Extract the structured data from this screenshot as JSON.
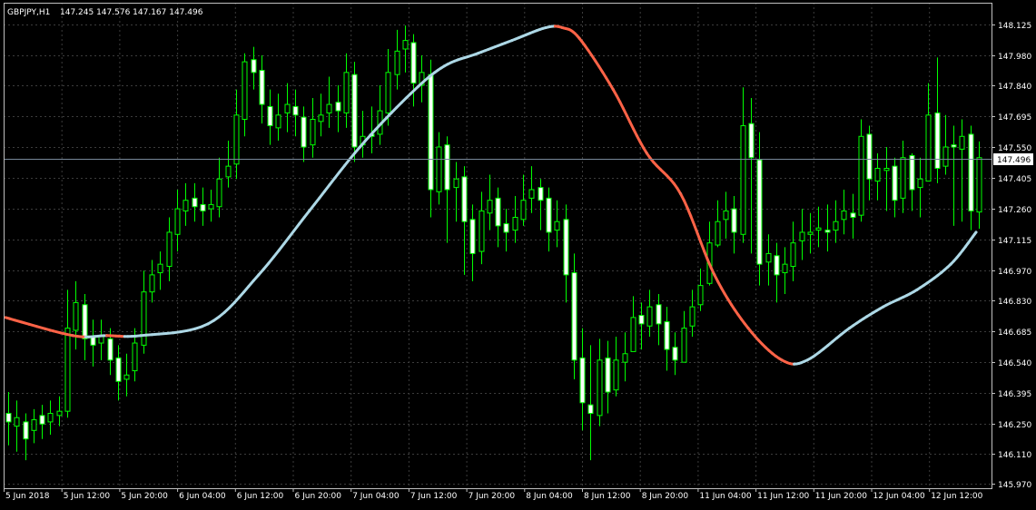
{
  "header": {
    "symbol": "GBPJPY,H1",
    "quote": "147.245 147.576 147.167 147.496"
  },
  "colors": {
    "background": "#000000",
    "grid": "#3c3c3c",
    "frame": "#c0c0c0",
    "candle": "#00ff00",
    "ma_up": "#add8e6",
    "ma_down": "#ff6347",
    "price_line": "#778899",
    "text": "#ffffff"
  },
  "chart_data": {
    "type": "candlestick",
    "title": "GBPJPY,H1",
    "ohlc_label": "147.245 147.576 147.167 147.496",
    "ylim": [
      145.97,
      148.17
    ],
    "y_ticks": [
      148.125,
      147.98,
      147.84,
      147.695,
      147.55,
      147.405,
      147.26,
      147.115,
      146.97,
      146.83,
      146.685,
      146.54,
      146.395,
      146.25,
      146.11,
      145.97
    ],
    "y_tick_labels": [
      "148.125",
      "147.980",
      "147.840",
      "147.695",
      "147.550",
      "147.405",
      "147.260",
      "147.115",
      "146.970",
      "146.830",
      "146.685",
      "146.540",
      "146.395",
      "146.250",
      "146.110",
      "145.970"
    ],
    "x_labels": [
      "5 Jun 2018",
      "5 Jun 12:00",
      "5 Jun 20:00",
      "6 Jun 04:00",
      "6 Jun 12:00",
      "6 Jun 20:00",
      "7 Jun 04:00",
      "7 Jun 12:00",
      "7 Jun 20:00",
      "8 Jun 04:00",
      "8 Jun 12:00",
      "8 Jun 20:00",
      "11 Jun 04:00",
      "11 Jun 12:00",
      "11 Jun 20:00",
      "12 Jun 04:00",
      "12 Jun 12:00"
    ],
    "current_price": 147.496,
    "current_price_label": "147.496",
    "grid": true,
    "series": [
      {
        "type": "candlestick",
        "color": "#00ff00",
        "close": [
          146.26,
          146.28,
          146.18,
          146.27,
          146.25,
          146.3,
          146.31,
          146.7,
          146.82,
          146.65,
          146.62,
          146.66,
          146.55,
          146.45,
          146.48,
          146.63,
          146.87,
          146.95,
          147.0,
          147.15,
          147.26,
          147.3,
          147.27,
          147.25,
          147.28,
          147.4,
          147.46,
          147.7,
          147.95,
          147.9,
          147.75,
          147.65,
          147.7,
          147.75,
          147.7,
          147.55,
          147.68,
          147.7,
          147.75,
          147.72,
          147.9,
          147.55,
          147.6,
          147.6,
          147.72,
          147.9,
          148.0,
          148.05,
          147.85,
          147.9,
          147.35,
          147.55,
          147.35,
          147.4,
          147.2,
          147.05,
          147.25,
          147.3,
          147.18,
          147.15,
          147.22,
          147.3,
          147.35,
          147.3,
          147.15,
          147.2,
          146.95,
          146.55,
          146.35,
          146.3,
          146.55,
          146.4,
          146.55,
          146.58,
          146.75,
          146.72,
          146.8,
          146.72,
          146.6,
          146.55,
          146.7,
          146.8,
          146.9,
          147.1,
          147.2,
          147.25,
          147.15,
          147.65,
          147.5,
          147.0,
          147.05,
          146.95,
          147.0,
          147.1,
          147.15,
          147.15,
          147.17,
          147.15,
          147.2,
          147.25,
          147.22,
          147.6,
          147.4,
          147.45,
          147.45,
          147.3,
          147.5,
          147.35,
          147.4,
          147.7,
          147.45,
          147.55,
          147.55,
          147.6,
          147.25,
          147.5
        ],
        "open": [
          146.3,
          146.24,
          146.26,
          146.22,
          146.29,
          146.26,
          146.29,
          146.31,
          146.69,
          146.81,
          146.66,
          146.63,
          146.65,
          146.56,
          146.46,
          146.5,
          146.62,
          146.87,
          146.96,
          146.99,
          147.14,
          147.25,
          147.31,
          147.28,
          147.26,
          147.27,
          147.41,
          147.47,
          147.68,
          147.96,
          147.91,
          147.74,
          147.64,
          147.71,
          147.74,
          147.69,
          147.56,
          147.67,
          147.71,
          147.76,
          147.71,
          147.89,
          147.56,
          147.61,
          147.61,
          147.71,
          147.89,
          148.01,
          148.04,
          147.84,
          147.89,
          147.34,
          147.56,
          147.36,
          147.41,
          147.21,
          147.06,
          147.24,
          147.31,
          147.19,
          147.16,
          147.21,
          147.31,
          147.36,
          147.31,
          147.16,
          147.21,
          146.96,
          146.56,
          146.34,
          146.29,
          146.56,
          146.41,
          146.54,
          146.59,
          146.76,
          146.71,
          146.81,
          146.73,
          146.61,
          146.54,
          146.71,
          146.81,
          146.91,
          147.09,
          147.21,
          147.26,
          147.14,
          147.66,
          147.49,
          147.01,
          147.04,
          146.96,
          146.99,
          147.11,
          147.14,
          147.16,
          147.16,
          147.16,
          147.21,
          147.24,
          147.23,
          147.61,
          147.39,
          147.44,
          147.46,
          147.31,
          147.51,
          147.36,
          147.39,
          147.71,
          147.46,
          147.56,
          147.54,
          147.61,
          147.245
        ],
        "high": [
          146.4,
          146.36,
          146.3,
          146.32,
          146.34,
          146.36,
          146.38,
          146.88,
          146.92,
          146.86,
          146.74,
          146.74,
          146.7,
          146.62,
          146.58,
          146.7,
          146.97,
          147.02,
          147.06,
          147.22,
          147.35,
          147.38,
          147.38,
          147.36,
          147.35,
          147.5,
          147.58,
          147.82,
          147.99,
          148.02,
          147.98,
          147.82,
          147.8,
          147.85,
          147.82,
          147.74,
          147.78,
          147.8,
          147.88,
          147.84,
          147.99,
          147.95,
          147.72,
          147.74,
          147.84,
          148.01,
          148.1,
          148.12,
          148.08,
          147.98,
          147.96,
          147.62,
          147.6,
          147.48,
          147.46,
          147.28,
          147.34,
          147.42,
          147.36,
          147.26,
          147.32,
          147.42,
          147.46,
          147.4,
          147.36,
          147.3,
          147.28,
          147.05,
          146.7,
          146.62,
          146.65,
          146.64,
          146.66,
          146.68,
          146.85,
          146.82,
          146.88,
          146.86,
          146.8,
          146.68,
          146.78,
          146.88,
          146.98,
          147.2,
          147.3,
          147.34,
          147.32,
          147.83,
          147.78,
          147.62,
          147.14,
          147.1,
          147.08,
          147.2,
          147.26,
          147.24,
          147.27,
          147.28,
          147.3,
          147.35,
          147.33,
          147.68,
          147.65,
          147.52,
          147.55,
          147.5,
          147.58,
          147.52,
          147.5,
          147.85,
          147.97,
          147.7,
          147.65,
          147.68,
          147.65,
          147.576
        ],
        "low": [
          146.15,
          146.12,
          146.08,
          146.16,
          146.18,
          146.2,
          146.24,
          146.28,
          146.6,
          146.55,
          146.52,
          146.55,
          146.48,
          146.36,
          146.38,
          146.45,
          146.58,
          146.82,
          146.88,
          146.92,
          147.06,
          147.18,
          147.2,
          147.18,
          147.2,
          147.22,
          147.36,
          147.4,
          147.6,
          147.82,
          147.66,
          147.56,
          147.58,
          147.62,
          147.6,
          147.48,
          147.5,
          147.6,
          147.64,
          147.62,
          147.64,
          147.48,
          147.5,
          147.52,
          147.56,
          147.65,
          147.82,
          147.9,
          147.74,
          147.76,
          147.22,
          147.28,
          147.1,
          147.2,
          146.95,
          146.92,
          147.0,
          147.16,
          147.08,
          147.06,
          147.1,
          147.18,
          147.24,
          147.16,
          147.06,
          147.08,
          146.82,
          146.46,
          146.22,
          146.08,
          146.24,
          146.3,
          146.38,
          146.45,
          146.64,
          146.6,
          146.66,
          146.62,
          146.5,
          146.48,
          146.55,
          146.66,
          146.78,
          146.9,
          147.08,
          147.12,
          147.05,
          147.1,
          147.05,
          146.9,
          146.9,
          146.82,
          146.86,
          146.92,
          147.02,
          147.05,
          147.08,
          147.06,
          147.1,
          147.14,
          147.12,
          147.2,
          147.3,
          147.3,
          147.25,
          147.22,
          147.24,
          147.25,
          147.22,
          147.4,
          147.38,
          147.42,
          147.18,
          147.2,
          147.16,
          147.167
        ]
      },
      {
        "type": "line",
        "color_up": "#add8e6",
        "color_down": "#ff6347",
        "x": [
          0,
          8,
          12,
          16,
          24,
          30,
          36,
          42,
          48,
          52,
          56,
          60,
          64,
          66,
          68,
          72,
          76,
          80,
          84,
          88,
          92,
          95,
          100,
          104,
          108,
          112,
          115
        ],
        "y": [
          146.75,
          146.665,
          146.665,
          146.665,
          146.72,
          146.95,
          147.25,
          147.55,
          147.8,
          147.93,
          147.99,
          148.05,
          148.11,
          148.11,
          148.06,
          147.82,
          147.52,
          147.33,
          146.95,
          146.7,
          146.55,
          146.55,
          146.7,
          146.8,
          146.88,
          147.0,
          147.15
        ]
      }
    ]
  }
}
